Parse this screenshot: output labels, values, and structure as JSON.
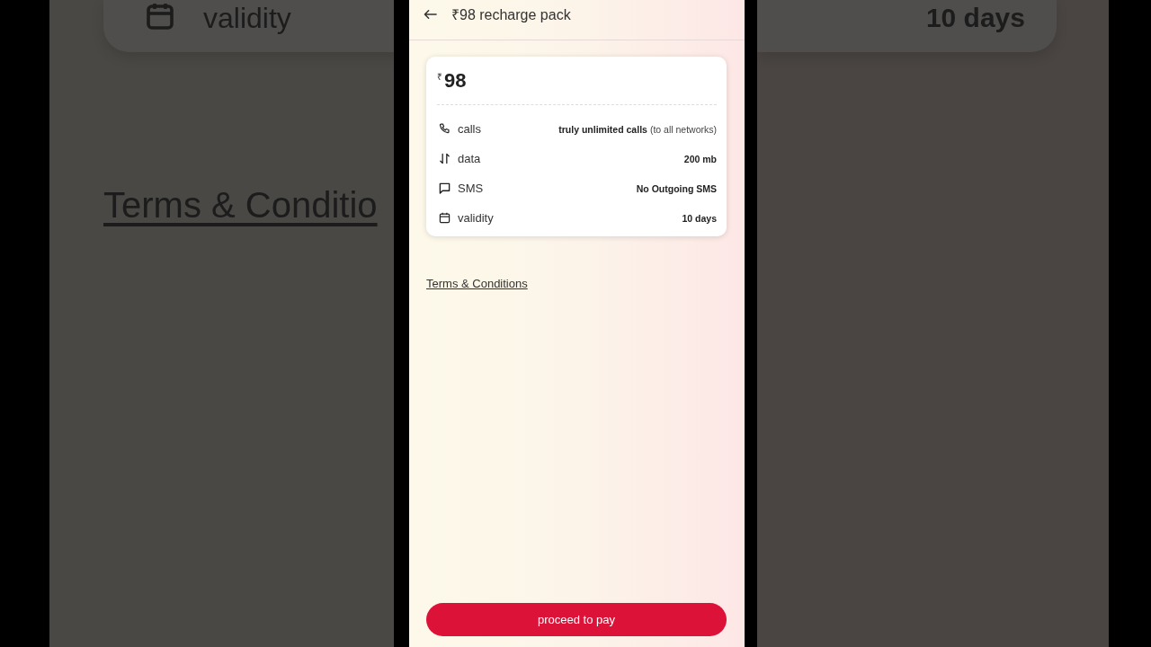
{
  "background": {
    "left": {
      "label": "validity",
      "link": "Terms & Conditio"
    },
    "right": {
      "value": "10 days"
    }
  },
  "header": {
    "title": "₹98 recharge pack"
  },
  "pack": {
    "currency": "₹",
    "price": "98",
    "benefits": [
      {
        "kind": "calls",
        "label": "calls",
        "value": "truly unlimited calls",
        "note": "(to all networks)"
      },
      {
        "kind": "data",
        "label": "data",
        "value": "200 mb"
      },
      {
        "kind": "sms",
        "label": "SMS",
        "value": "No Outgoing SMS"
      },
      {
        "kind": "validity",
        "label": "validity",
        "value": "10 days"
      }
    ]
  },
  "terms_link": "Terms & Conditions",
  "pay_button": {
    "label": "proceed to pay"
  }
}
